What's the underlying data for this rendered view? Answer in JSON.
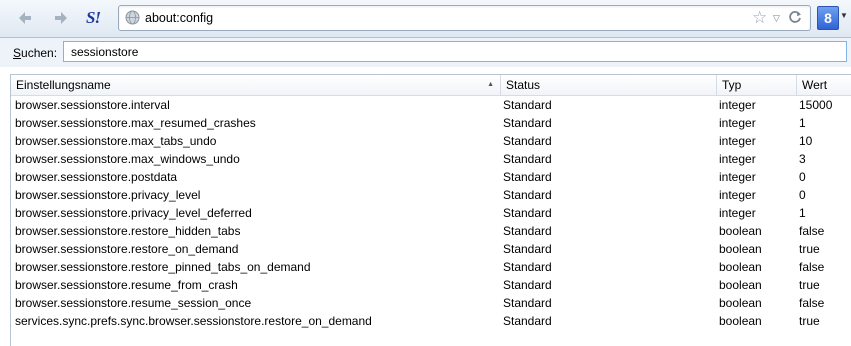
{
  "toolbar": {
    "url": "about:config",
    "search_engine_letter": "8",
    "extension_letters": "S!"
  },
  "icons": {
    "back": "back-arrow-icon",
    "forward": "forward-arrow-icon",
    "extension": "extension-icon",
    "site": "globe-icon",
    "bookmark": "star-icon",
    "history": "dropdown-arrow-icon",
    "reload": "reload-icon",
    "search_engine": "google-icon"
  },
  "search": {
    "label_first": "S",
    "label_rest": "uchen:",
    "value": "sessionstore"
  },
  "table": {
    "headers": {
      "name": "Einstellungsname",
      "status": "Status",
      "type": "Typ",
      "value": "Wert"
    },
    "rows": [
      {
        "name": "browser.sessionstore.interval",
        "status": "Standard",
        "type": "integer",
        "value": "15000"
      },
      {
        "name": "browser.sessionstore.max_resumed_crashes",
        "status": "Standard",
        "type": "integer",
        "value": "1"
      },
      {
        "name": "browser.sessionstore.max_tabs_undo",
        "status": "Standard",
        "type": "integer",
        "value": "10"
      },
      {
        "name": "browser.sessionstore.max_windows_undo",
        "status": "Standard",
        "type": "integer",
        "value": "3"
      },
      {
        "name": "browser.sessionstore.postdata",
        "status": "Standard",
        "type": "integer",
        "value": "0"
      },
      {
        "name": "browser.sessionstore.privacy_level",
        "status": "Standard",
        "type": "integer",
        "value": "0"
      },
      {
        "name": "browser.sessionstore.privacy_level_deferred",
        "status": "Standard",
        "type": "integer",
        "value": "1"
      },
      {
        "name": "browser.sessionstore.restore_hidden_tabs",
        "status": "Standard",
        "type": "boolean",
        "value": "false"
      },
      {
        "name": "browser.sessionstore.restore_on_demand",
        "status": "Standard",
        "type": "boolean",
        "value": "true"
      },
      {
        "name": "browser.sessionstore.restore_pinned_tabs_on_demand",
        "status": "Standard",
        "type": "boolean",
        "value": "false"
      },
      {
        "name": "browser.sessionstore.resume_from_crash",
        "status": "Standard",
        "type": "boolean",
        "value": "true"
      },
      {
        "name": "browser.sessionstore.resume_session_once",
        "status": "Standard",
        "type": "boolean",
        "value": "false"
      },
      {
        "name": "services.sync.prefs.sync.browser.sessionstore.restore_on_demand",
        "status": "Standard",
        "type": "boolean",
        "value": "true"
      }
    ]
  }
}
